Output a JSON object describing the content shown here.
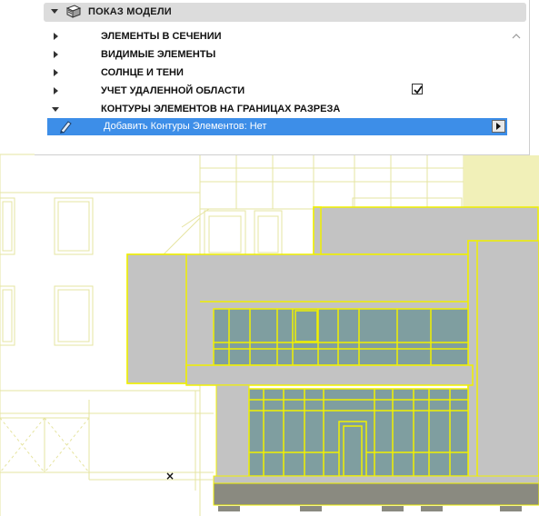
{
  "panel": {
    "title": "ПОКАЗ МОДЕЛИ",
    "rows": [
      {
        "label": "ЭЛЕМЕНТЫ В СЕЧЕНИИ",
        "expanded": false
      },
      {
        "label": "ВИДИМЫЕ ЭЛЕМЕНТЫ",
        "expanded": false
      },
      {
        "label": "СОЛНЦЕ И ТЕНИ",
        "expanded": false
      },
      {
        "label": "УЧЕТ УДАЛЕННОЙ ОБЛАСТИ",
        "expanded": false,
        "checked": true
      },
      {
        "label": "КОНТУРЫ ЭЛЕМЕНТОВ НА ГРАНИЦАХ РАЗРЕЗА",
        "expanded": true
      }
    ],
    "selected_option": "Добавить Контуры Элементов: Нет"
  },
  "colors": {
    "accent": "#3d8ee8",
    "outline": "#f0f000",
    "wall_fill": "#c3c3c3",
    "glass_fill": "#7f9ea0",
    "ground_fill": "#8a8a80",
    "background_line": "#e9e8a6"
  },
  "icons": {
    "panel_header": "model-display-icon",
    "selected_row": "pen-icon",
    "canvas_marker": "cross-marker-icon"
  },
  "canvas": {
    "marker": "×"
  }
}
